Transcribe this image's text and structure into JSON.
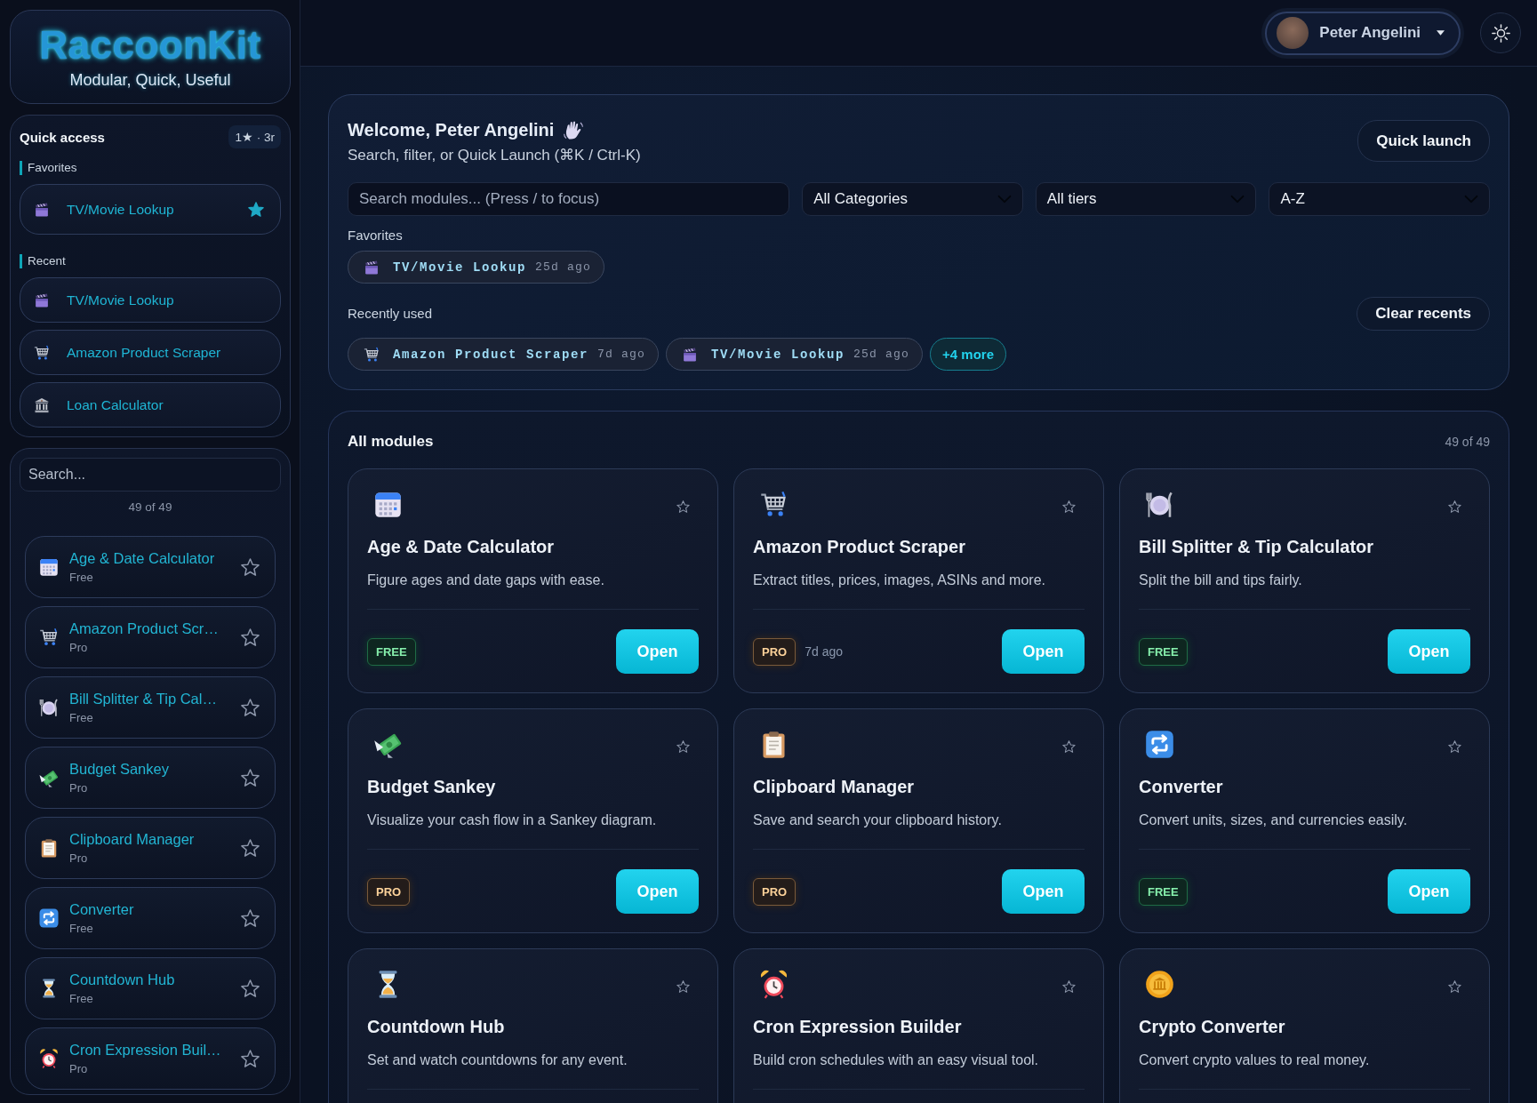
{
  "sidebar": {
    "logo": {
      "text": "RaccoonKit",
      "tagline": "Modular, Quick, Useful"
    },
    "quick_access": {
      "title": "Quick access",
      "badge": "1★ · 3r",
      "sections": [
        {
          "label": "Favorites",
          "items": [
            {
              "kind": "clapper",
              "name": "TV/Movie Lookup",
              "favorite": true
            }
          ]
        },
        {
          "label": "Recent",
          "items": [
            {
              "kind": "clapper",
              "name": "TV/Movie Lookup"
            },
            {
              "kind": "cart",
              "name": "Amazon Product Scraper"
            },
            {
              "kind": "bank",
              "name": "Loan Calculator"
            }
          ]
        }
      ]
    },
    "modules": {
      "search": {
        "placeholder": "Search..."
      },
      "count": "49 of 49",
      "items": [
        {
          "kind": "calendar",
          "name": "Age & Date Calculator",
          "tier": "Free",
          "favorite": false
        },
        {
          "kind": "cart",
          "name": "Amazon Product Scr…",
          "tier": "Pro",
          "favorite": false
        },
        {
          "kind": "plate",
          "name": "Bill Splitter & Tip Cal…",
          "tier": "Free",
          "favorite": false
        },
        {
          "kind": "money",
          "name": "Budget Sankey",
          "tier": "Pro",
          "favorite": false
        },
        {
          "kind": "clipboard",
          "name": "Clipboard Manager",
          "tier": "Pro",
          "favorite": false
        },
        {
          "kind": "repeat",
          "name": "Converter",
          "tier": "Free",
          "favorite": false
        },
        {
          "kind": "hourglass",
          "name": "Countdown Hub",
          "tier": "Free",
          "favorite": false
        },
        {
          "kind": "alarm",
          "name": "Cron Expression Buil…",
          "tier": "Pro",
          "favorite": false
        }
      ]
    }
  },
  "header": {
    "user": {
      "name": "Peter Angelini"
    }
  },
  "welcome": {
    "title": "Welcome, Peter Angelini",
    "subtitle": "Search, filter, or Quick Launch (⌘K / Ctrl-K)",
    "quick_launch": "Quick launch",
    "search": {
      "placeholder": "Search modules... (Press / to focus)"
    },
    "filters": [
      {
        "value": "All Categories"
      },
      {
        "value": "All tiers"
      },
      {
        "value": "A-Z"
      }
    ],
    "favorites": {
      "label": "Favorites",
      "chips": [
        {
          "kind": "clapper",
          "name": "TV/Movie Lookup",
          "ago": "25d ago"
        }
      ]
    },
    "recent": {
      "label": "Recently used",
      "clear": "Clear recents",
      "chips": [
        {
          "kind": "cart",
          "name": "Amazon Product Scraper",
          "ago": "7d ago"
        },
        {
          "kind": "clapper",
          "name": "TV/Movie Lookup",
          "ago": "25d ago"
        }
      ],
      "more": "+4 more"
    }
  },
  "all_modules": {
    "title": "All modules",
    "count": "49 of 49",
    "cards": [
      {
        "kind": "calendar",
        "title": "Age & Date Calculator",
        "description": "Figure ages and date gaps with ease.",
        "favorite": false,
        "badge": {
          "text": "FREE",
          "kind": "free"
        },
        "action": "Open"
      },
      {
        "kind": "cart",
        "title": "Amazon Product Scraper",
        "description": "Extract titles, prices, images, ASINs and more.",
        "favorite": false,
        "badge": {
          "text": "PRO",
          "kind": "pro"
        },
        "last_used": "7d ago",
        "action": "Open"
      },
      {
        "kind": "plate",
        "title": "Bill Splitter & Tip Calculator",
        "description": "Split the bill and tips fairly.",
        "favorite": false,
        "badge": {
          "text": "FREE",
          "kind": "free"
        },
        "action": "Open"
      },
      {
        "kind": "money",
        "title": "Budget Sankey",
        "description": "Visualize your cash flow in a Sankey diagram.",
        "favorite": false,
        "badge": {
          "text": "PRO",
          "kind": "pro"
        },
        "action": "Open"
      },
      {
        "kind": "clipboard",
        "title": "Clipboard Manager",
        "description": "Save and search your clipboard history.",
        "favorite": false,
        "badge": {
          "text": "PRO",
          "kind": "pro"
        },
        "action": "Open"
      },
      {
        "kind": "repeat",
        "title": "Converter",
        "description": "Convert units, sizes, and currencies easily.",
        "favorite": false,
        "badge": {
          "text": "FREE",
          "kind": "free"
        },
        "action": "Open"
      },
      {
        "kind": "hourglass",
        "title": "Countdown Hub",
        "description": "Set and watch countdowns for any event.",
        "favorite": false
      },
      {
        "kind": "alarm",
        "title": "Cron Expression Builder",
        "description": "Build cron schedules with an easy visual tool.",
        "favorite": false
      },
      {
        "kind": "coin",
        "title": "Crypto Converter",
        "description": "Convert crypto values to real money.",
        "favorite": false
      }
    ]
  }
}
